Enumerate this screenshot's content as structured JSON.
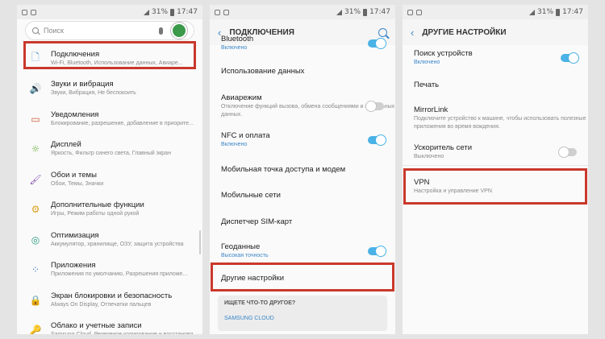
{
  "statusbar": {
    "battery": "31%",
    "time": "17:47"
  },
  "screen1": {
    "search_placeholder": "Поиск",
    "items": [
      {
        "icon": "🗋",
        "icon_name": "file-icon",
        "title": "Подключения",
        "sub": "Wi-Fi, Bluetooth, Использование данных, Авиаре...",
        "color": "#4a90c8"
      },
      {
        "icon": "🔊",
        "icon_name": "speaker-icon",
        "title": "Звуки и вибрация",
        "sub": "Звуки, Вибрация, Не беспокоить",
        "color": "#d35f8c"
      },
      {
        "icon": "▭",
        "icon_name": "notification-icon",
        "title": "Уведомления",
        "sub": "Блокирование, разрешение, добавление в приорите...",
        "color": "#cc5a3a"
      },
      {
        "icon": "☼",
        "icon_name": "display-icon",
        "title": "Дисплей",
        "sub": "Яркость, Фильтр синего света, Главный экран",
        "color": "#6aae3a"
      },
      {
        "icon": "🖌",
        "icon_name": "brush-icon",
        "title": "Обои и темы",
        "sub": "Обои, Темы, Значки",
        "color": "#8a55b5"
      },
      {
        "icon": "⚙",
        "icon_name": "gear-plus-icon",
        "title": "Дополнительные функции",
        "sub": "Игры, Режим работы одной рукой",
        "color": "#e0a020"
      },
      {
        "icon": "◎",
        "icon_name": "optimization-icon",
        "title": "Оптимизация",
        "sub": "Аккумулятор, хранилище, ОЗУ, защита устройства",
        "color": "#2a9a80"
      },
      {
        "icon": "⁘",
        "icon_name": "apps-icon",
        "title": "Приложения",
        "sub": "Приложения по умолчанию, Разрешения приложе...",
        "color": "#4a7cc8"
      },
      {
        "icon": "🔒",
        "icon_name": "lock-icon",
        "title": "Экран блокировки и безопасность",
        "sub": "Always On Display, Отпечатки пальцев",
        "color": "#4a7cc8"
      },
      {
        "icon": "🔑",
        "icon_name": "key-icon",
        "title": "Облако и учетные записи",
        "sub": "Samsung Cloud, Резервное копирование и восстановл...",
        "color": "#e08a20"
      }
    ]
  },
  "screen2": {
    "header": "ПОДКЛЮЧЕНИЯ",
    "items": [
      {
        "title": "Bluetooth",
        "sub": "Включено",
        "toggle": "on"
      },
      {
        "title": "Использование данных",
        "sub": "",
        "toggle": ""
      },
      {
        "title": "Авиарежим",
        "sub": "Отключение функций вызова, обмена сообщениями и мобильных данных.",
        "toggle": "off"
      },
      {
        "title": "NFC и оплата",
        "sub": "Включено",
        "toggle": "on"
      },
      {
        "title": "Мобильная точка доступа и модем",
        "sub": "",
        "toggle": ""
      },
      {
        "title": "Мобильные сети",
        "sub": "",
        "toggle": ""
      },
      {
        "title": "Диспетчер SIM-карт",
        "sub": "",
        "toggle": ""
      },
      {
        "title": "Геоданные",
        "sub": "Высокая точность",
        "toggle": "on"
      },
      {
        "title": "Другие настройки",
        "sub": "",
        "toggle": ""
      }
    ],
    "card_title": "ИЩЕТЕ ЧТО-ТО ДРУГОЕ?",
    "card_link": "SAMSUNG CLOUD"
  },
  "screen3": {
    "header": "ДРУГИЕ НАСТРОЙКИ",
    "items": [
      {
        "title": "Поиск устройств",
        "sub": "Включено",
        "toggle": "on"
      },
      {
        "title": "Печать",
        "sub": "",
        "toggle": ""
      },
      {
        "title": "MirrorLink",
        "sub": "Подключите устройство к машине, чтобы использовать полезные приложения во время вождения.",
        "toggle": ""
      },
      {
        "title": "Ускоритель сети",
        "sub": "Выключено",
        "toggle": "off"
      },
      {
        "title": "VPN",
        "sub": "Настройка и управление VPN",
        "toggle": ""
      }
    ]
  }
}
